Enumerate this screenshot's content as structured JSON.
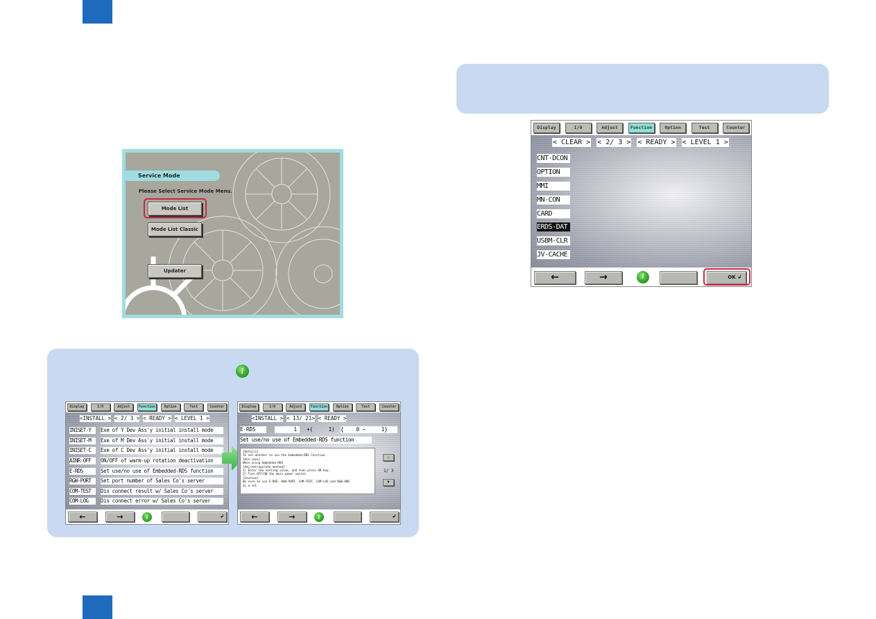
{
  "service_mode": {
    "title": "Service Mode",
    "prompt": "Please Select Service Mode Menu.",
    "buttons": {
      "mode_list": "Mode List",
      "mode_list_classic": "Mode List Classic",
      "updater": "Updater"
    },
    "highlighted": "Mode List"
  },
  "panel_main": {
    "tabs": [
      "Display",
      "I/O",
      "Adjust",
      "Function",
      "Option",
      "Test",
      "Counter"
    ],
    "active_tab": "Function",
    "nav": [
      "< CLEAR >",
      "< 2/ 3 >",
      "< READY >",
      "< LEVEL 1 >"
    ],
    "items": [
      "CNT-DCON",
      "OPTION",
      "MMI",
      "MN-CON",
      "CARD",
      "ERDS-DAT",
      "USBM-CLR",
      "JV-CACHE"
    ],
    "selected_item": "ERDS-DAT",
    "footer": {
      "back": "←",
      "forward": "→",
      "info": "i",
      "blank": "",
      "ok": "OK ↲"
    },
    "highlighted": "OK"
  },
  "panel_install_list": {
    "tabs": [
      "Display",
      "I/O",
      "Adjust",
      "Function",
      "Option",
      "Test",
      "Counter"
    ],
    "active_tab": "Function",
    "nav": [
      "<INSTALL >",
      "< 2/ 3 >",
      "< READY >",
      "< LEVEL 1 >"
    ],
    "items": [
      {
        "label": "INISET-Y",
        "desc": "Exe of Y Dev Ass'y initial install mode"
      },
      {
        "label": "INISET-M",
        "desc": "Exe of M Dev Ass'y initial install mode"
      },
      {
        "label": "INISET-C",
        "desc": "Exe of C Dev Ass'y initial install mode"
      },
      {
        "label": "AINR-OFF",
        "desc": "ON/OFF of warm-up rotation deactivation"
      },
      {
        "label": "E-RDS",
        "desc": "Set use/no use of Embedded-RDS function"
      },
      {
        "label": "RGW-PORT",
        "desc": "Set port number of Sales Co's server"
      },
      {
        "label": "COM-TEST",
        "desc": "Dis connect result w/ Sales Co's server"
      },
      {
        "label": "COM-LOG",
        "desc": "Dis connect error w/ Sales Co's server"
      }
    ],
    "footer": {
      "back": "←",
      "forward": "→",
      "info": "i",
      "blank": "",
      "ok": "↲"
    }
  },
  "panel_install_detail": {
    "tabs": [
      "Display",
      "I/O",
      "Adjust",
      "Function",
      "Option",
      "Test",
      "Counter"
    ],
    "active_tab": "Function",
    "nav": [
      "<INSTALL >",
      "< 13/ 21>",
      "< READY >"
    ],
    "item": {
      "label": "E-RDS",
      "value": "1",
      "default": "+(     1)",
      "range": "{    0 ~     1}"
    },
    "description": "Set use/no use of Embedded-RDS function",
    "details": "[Details]\nTo set whether to use the Embedded-RDS function.\n[Use case]\nWhen using Embedded-RDS\n[Adj/set/operate method]\n1) Enter the setting value, and then press OK key.\n2) Turn OFF/ON the main power switch.\n[Caution]\nBe sure to use E-RDS, RGW-PORT, COM-TEST, COM-LOG and RGW-ADR\nas a set.",
    "page": "1/ 3",
    "scroll_up": "▲",
    "scroll_down": "▼",
    "footer": {
      "back": "←",
      "forward": "→",
      "info": "i",
      "blank": "",
      "ok": "↲"
    }
  },
  "colors": {
    "corner_tab": "#1e6bbd",
    "note_bg": "#c9d9f1",
    "highlight_ring": "#c8283c",
    "active_tab": "#8fe0d8",
    "service_frame": "#9fdde2"
  }
}
